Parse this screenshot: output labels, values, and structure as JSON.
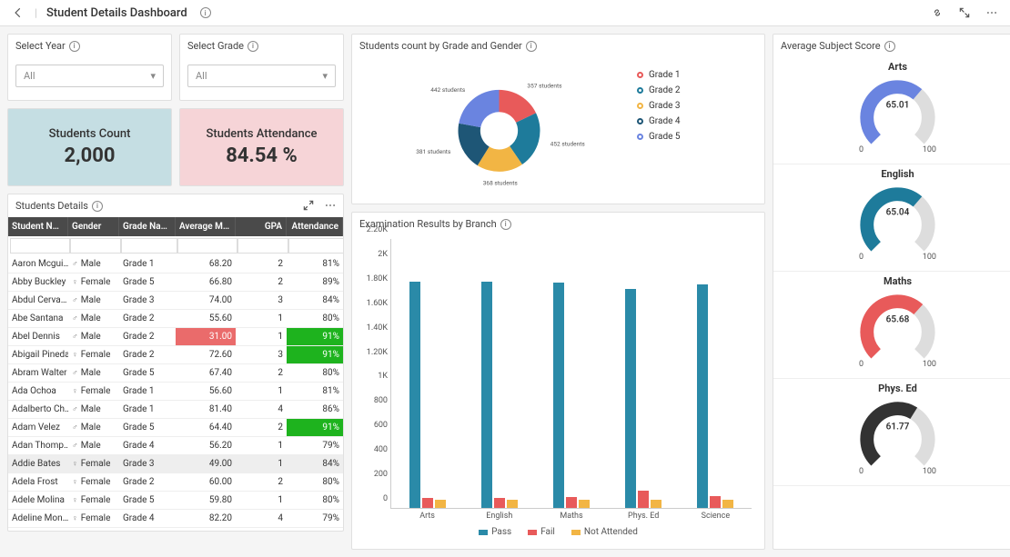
{
  "header": {
    "title": "Student Details Dashboard"
  },
  "filters": {
    "year": {
      "label": "Select Year",
      "value": "All"
    },
    "grade": {
      "label": "Select Grade",
      "value": "All"
    }
  },
  "kpi": {
    "count_label": "Students Count",
    "count_value": "2,000",
    "attendance_label": "Students Attendance",
    "attendance_value": "84.54 %"
  },
  "donut": {
    "title": "Students count by Grade and Gender",
    "legend": [
      "Grade 1",
      "Grade 2",
      "Grade 3",
      "Grade 4",
      "Grade 5"
    ],
    "colors": [
      "#e85a5a",
      "#1e7b9b",
      "#f2b544",
      "#1e5676",
      "#6a84e0"
    ],
    "labels": {
      "g1": "357 students",
      "g2": "452 students",
      "g3": "368 students",
      "g4": "381 students",
      "g5": "442 students"
    }
  },
  "table": {
    "title": "Students Details",
    "headers": [
      "Student Na…",
      "Gender",
      "Grade Name",
      "Average Ma…",
      "GPA",
      "Attendance"
    ],
    "rows": [
      {
        "name": "Aaron Mcgui…",
        "gender": "Male",
        "gicon": "♂",
        "grade": "Grade 1",
        "avg": "68.20",
        "gpa": "2",
        "att": "81%",
        "hl": false
      },
      {
        "name": "Abby Buckley",
        "gender": "Female",
        "gicon": "♀",
        "grade": "Grade 5",
        "avg": "66.80",
        "gpa": "2",
        "att": "89%",
        "hl": false
      },
      {
        "name": "Abdul Cerva…",
        "gender": "Male",
        "gicon": "♂",
        "grade": "Grade 3",
        "avg": "74.00",
        "gpa": "3",
        "att": "84%",
        "hl": false
      },
      {
        "name": "Abe Santana",
        "gender": "Male",
        "gicon": "♂",
        "grade": "Grade 2",
        "avg": "55.60",
        "gpa": "1",
        "att": "80%",
        "hl": false
      },
      {
        "name": "Abel Dennis",
        "gender": "Male",
        "gicon": "♂",
        "grade": "Grade 2",
        "avg": "31.00",
        "gpa": "1",
        "att": "91%",
        "hl": false,
        "avg_low": true,
        "att_high": true
      },
      {
        "name": "Abigail Pineda",
        "gender": "Female",
        "gicon": "♀",
        "grade": "Grade 2",
        "avg": "72.60",
        "gpa": "3",
        "att": "91%",
        "hl": false,
        "att_high": true
      },
      {
        "name": "Abram Walter",
        "gender": "Male",
        "gicon": "♂",
        "grade": "Grade 5",
        "avg": "67.40",
        "gpa": "2",
        "att": "80%",
        "hl": false
      },
      {
        "name": "Ada Ochoa",
        "gender": "Female",
        "gicon": "♀",
        "grade": "Grade 1",
        "avg": "56.60",
        "gpa": "1",
        "att": "81%",
        "hl": false
      },
      {
        "name": "Adalberto Ch…",
        "gender": "Male",
        "gicon": "♂",
        "grade": "Grade 1",
        "avg": "81.40",
        "gpa": "4",
        "att": "86%",
        "hl": false
      },
      {
        "name": "Adam Velez",
        "gender": "Male",
        "gicon": "♂",
        "grade": "Grade 5",
        "avg": "64.40",
        "gpa": "2",
        "att": "91%",
        "hl": false,
        "att_high": true
      },
      {
        "name": "Adan Thomp…",
        "gender": "Male",
        "gicon": "♂",
        "grade": "Grade 4",
        "avg": "56.20",
        "gpa": "1",
        "att": "79%",
        "hl": false
      },
      {
        "name": "Addie Bates",
        "gender": "Female",
        "gicon": "♀",
        "grade": "Grade 3",
        "avg": "49.00",
        "gpa": "1",
        "att": "84%",
        "hl": true
      },
      {
        "name": "Adela Frost",
        "gender": "Female",
        "gicon": "♀",
        "grade": "Grade 2",
        "avg": "60.00",
        "gpa": "2",
        "att": "80%",
        "hl": false
      },
      {
        "name": "Adele Molina",
        "gender": "Female",
        "gicon": "♀",
        "grade": "Grade 5",
        "avg": "59.80",
        "gpa": "1",
        "att": "80%",
        "hl": false
      },
      {
        "name": "Adeline Mon…",
        "gender": "Female",
        "gicon": "♀",
        "grade": "Grade 4",
        "avg": "82.20",
        "gpa": "4",
        "att": "79%",
        "hl": false
      }
    ]
  },
  "bars": {
    "title": "Examination Results by Branch",
    "yticks": [
      "0",
      "200",
      "400",
      "600",
      "800",
      "1K",
      "1.20K",
      "1.40K",
      "1.60K",
      "1.80K",
      "2K",
      "2.20K"
    ],
    "legend": [
      "Pass",
      "Fail",
      "Not Attended"
    ],
    "colors": {
      "pass": "#2a8aa8",
      "fail": "#e85a5a",
      "na": "#f2b544"
    }
  },
  "gauges": {
    "title": "Average Subject Score",
    "min": "0",
    "max": "100",
    "items": [
      {
        "name": "Arts",
        "val": "65.01",
        "color": "#6a84e0",
        "pct": 65.01
      },
      {
        "name": "English",
        "val": "65.04",
        "color": "#1e7b9b",
        "pct": 65.04
      },
      {
        "name": "Maths",
        "val": "65.68",
        "color": "#e85a5a",
        "pct": 65.68
      },
      {
        "name": "Phys. Ed",
        "val": "61.77",
        "color": "#333333",
        "pct": 61.77
      }
    ]
  },
  "chart_data": {
    "donut": {
      "type": "pie",
      "title": "Students count by Grade and Gender",
      "categories": [
        "Grade 1",
        "Grade 2",
        "Grade 3",
        "Grade 4",
        "Grade 5"
      ],
      "values": [
        357,
        452,
        368,
        381,
        442
      ]
    },
    "bars": {
      "type": "bar",
      "title": "Examination Results by Branch",
      "categories": [
        "Arts",
        "English",
        "Maths",
        "Phys. Ed",
        "Science"
      ],
      "series": [
        {
          "name": "Pass",
          "values": [
            1850,
            1850,
            1840,
            1790,
            1830
          ]
        },
        {
          "name": "Fail",
          "values": [
            80,
            80,
            90,
            140,
            100
          ]
        },
        {
          "name": "Not Attended",
          "values": [
            70,
            70,
            70,
            70,
            70
          ]
        }
      ],
      "ylim": [
        0,
        2200
      ]
    },
    "gauges": {
      "type": "bar",
      "categories": [
        "Arts",
        "English",
        "Maths",
        "Phys. Ed"
      ],
      "values": [
        65.01,
        65.04,
        65.68,
        61.77
      ],
      "ylim": [
        0,
        100
      ]
    }
  }
}
